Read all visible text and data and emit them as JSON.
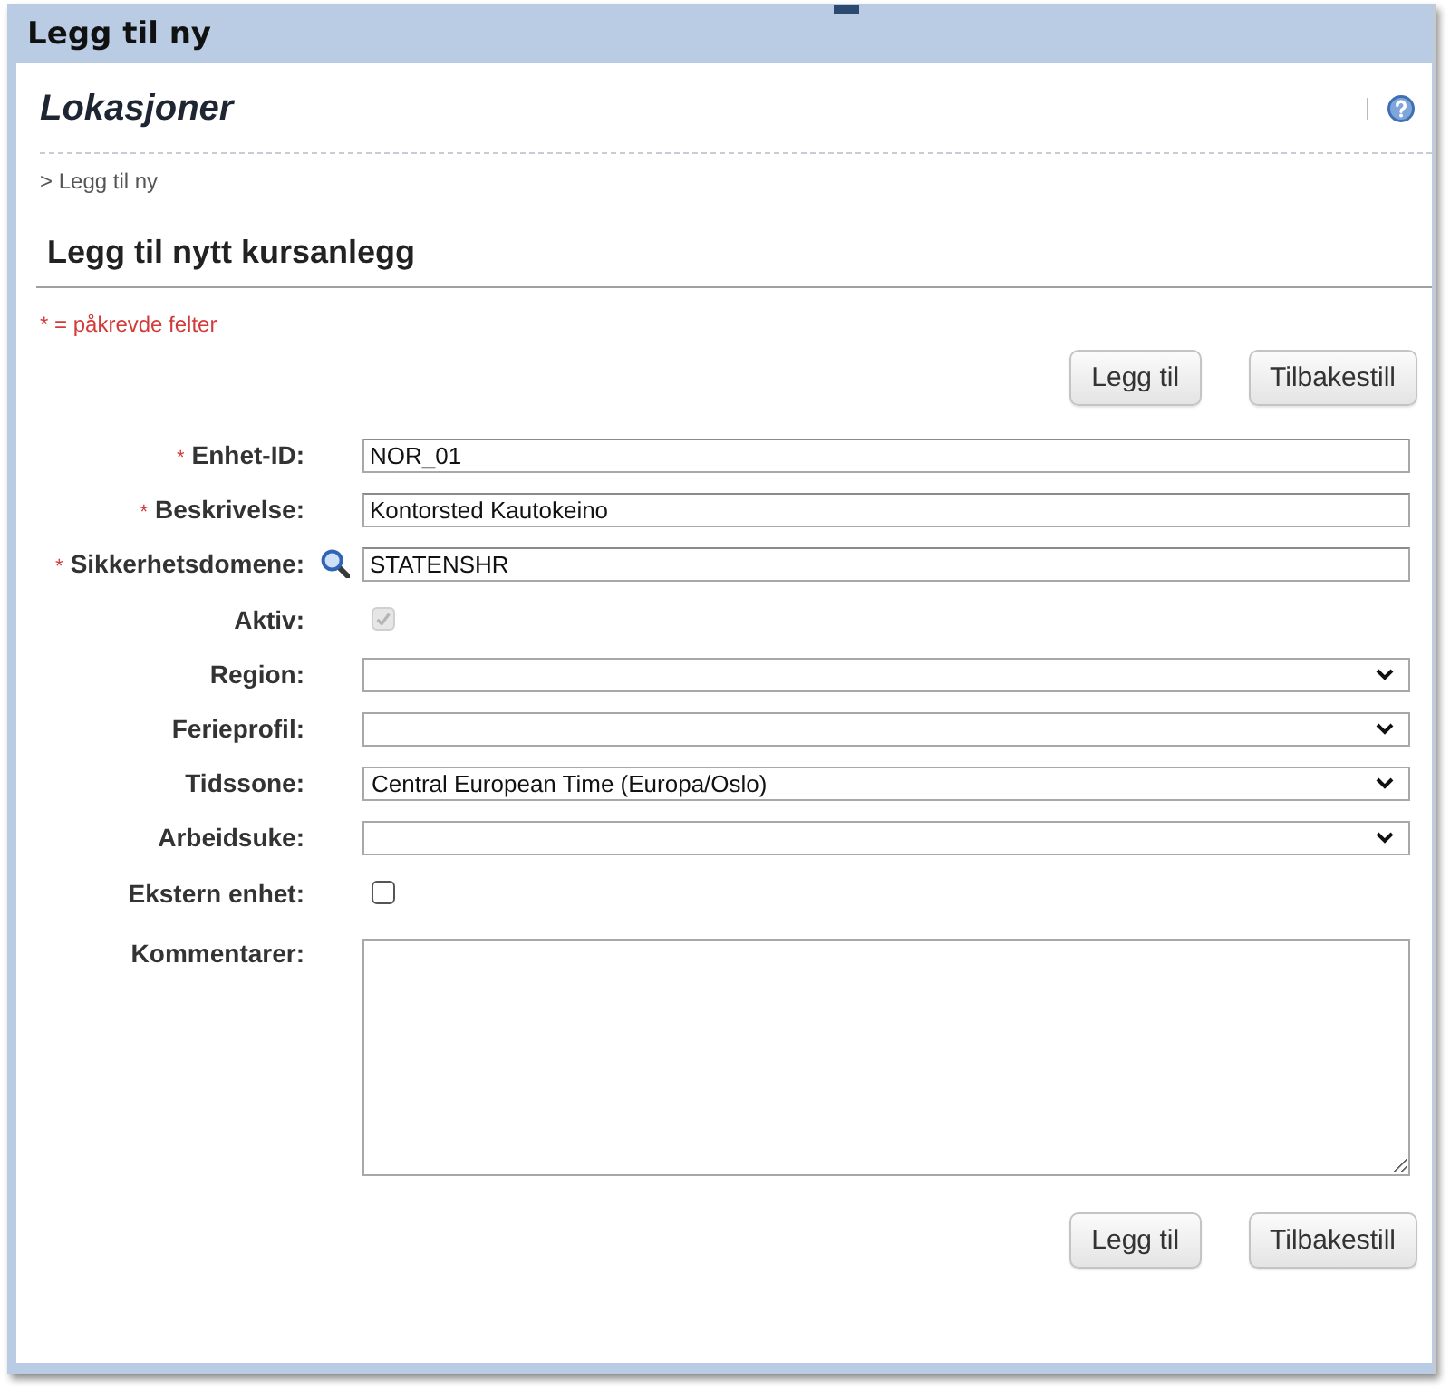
{
  "window": {
    "title": "Legg til ny"
  },
  "page": {
    "title": "Lokasjoner",
    "breadcrumb": "> Legg til ny",
    "heading": "Legg til nytt kursanlegg",
    "required_note": "* = påkrevde felter"
  },
  "top_buttons": [
    "Legg til",
    "Tilbakestill"
  ],
  "fields": [
    {
      "kind": "text",
      "label": "Enhet-ID:",
      "required_mark": "*",
      "value": "NOR_01",
      "disabled": false
    },
    {
      "kind": "text",
      "label": "Beskrivelse:",
      "required_mark": "*",
      "value": "Kontorsted Kautokeino",
      "disabled": false
    },
    {
      "kind": "lookup",
      "label": "Sikkerhetsdomene:",
      "required_mark": "*",
      "value": "STATENSHR",
      "disabled": false
    },
    {
      "kind": "checkbox",
      "label": "Aktiv:",
      "checked": true,
      "disabled": true
    },
    {
      "kind": "select",
      "label": "Region:",
      "disabled": false
    },
    {
      "kind": "select",
      "label": "Ferieprofil:",
      "disabled": false
    },
    {
      "kind": "select",
      "label": "Tidssone:",
      "value": "Central European Time (Europa/Oslo)",
      "disabled": false
    },
    {
      "kind": "select",
      "label": "Arbeidsuke:",
      "disabled": false
    },
    {
      "kind": "checkbox",
      "label": "Ekstern enhet:",
      "checked": false,
      "disabled": false
    },
    {
      "kind": "textarea",
      "label": "Kommentarer:",
      "disabled": false
    }
  ],
  "bottom_buttons": [
    "Legg til",
    "Tilbakestill"
  ]
}
